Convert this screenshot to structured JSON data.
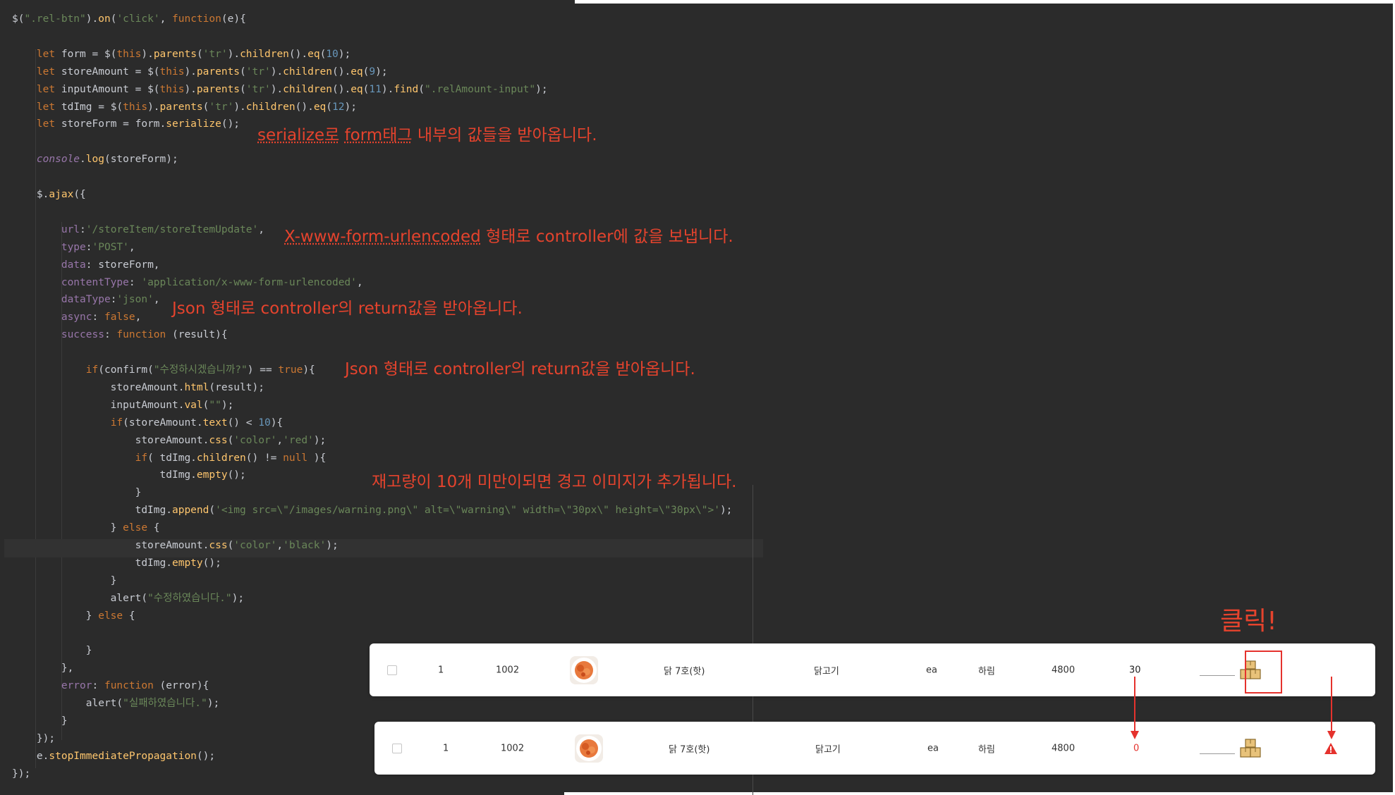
{
  "code_lines": [
    "$(\".rel-btn\").on('click', function(e){",
    "",
    "    let form = $(this).parents('tr').children().eq(10);",
    "    let storeAmount = $(this).parents('tr').children().eq(9);",
    "    let inputAmount = $(this).parents('tr').children().eq(11).find(\".relAmount-input\");",
    "    let tdImg = $(this).parents('tr').children().eq(12);",
    "    let storeForm = form.serialize();",
    "",
    "    console.log(storeForm);",
    "",
    "    $.ajax({",
    "",
    "        url:'/storeItem/storeItemUpdate',",
    "        type:'POST',",
    "        data: storeForm,",
    "        contentType: 'application/x-www-form-urlencoded',",
    "        dataType:'json',",
    "        async: false,",
    "        success: function (result){",
    "",
    "            if(confirm(\"수정하시겠습니까?\") == true){",
    "                storeAmount.html(result);",
    "                inputAmount.val(\"\");",
    "                if(storeAmount.text() < 10){",
    "                    storeAmount.css('color','red');",
    "                    if( tdImg.children() != null ){",
    "                        tdImg.empty();",
    "                    }",
    "                    tdImg.append('<img src=\\\"/images/warning.png\\\" alt=\\\"warning\\\" width=\\\"30px\\\" height=\\\"30px\\\">');",
    "                } else {",
    "                    storeAmount.css('color','black');",
    "                    tdImg.empty();",
    "                }",
    "                alert(\"수정하였습니다.\");",
    "            } else {",
    "",
    "            }",
    "        },",
    "        error: function (error){",
    "            alert(\"실패하였습니다.\");",
    "        }",
    "    });",
    "    e.stopImmediatePropagation();",
    "});"
  ],
  "annotations": {
    "serialize": {
      "u1": "serialize로",
      "u2": "form태그",
      "rest": "내부의 값들을 받아옵니다."
    },
    "urlencoded": {
      "u1": "X-www-form-urlencoded",
      "rest": "형태로 controller에 값을 보냅니다."
    },
    "json_return_1": "Json 형태로 controller의 return값을 받아옵니다.",
    "json_return_2": "Json 형태로 controller의 return값을 받아옵니다.",
    "stock_warning": "재고량이 10개 미만이되면 경고 이미지가 추가됩니다."
  },
  "click_label": "클릭!",
  "rows": [
    {
      "no": "1",
      "code": "1002",
      "name": "닭 7호(핫)",
      "category": "닭고기",
      "unit": "ea",
      "brand": "하림",
      "price": "4800",
      "stock": "30",
      "stock_color": "#222222"
    },
    {
      "no": "1",
      "code": "1002",
      "name": "닭 7호(핫)",
      "category": "닭고기",
      "unit": "ea",
      "brand": "하림",
      "price": "4800",
      "stock": "0",
      "stock_color": "#e5322d"
    }
  ],
  "colors": {
    "annotation": "#e5432d",
    "editor_bg": "#2b2b2b"
  }
}
